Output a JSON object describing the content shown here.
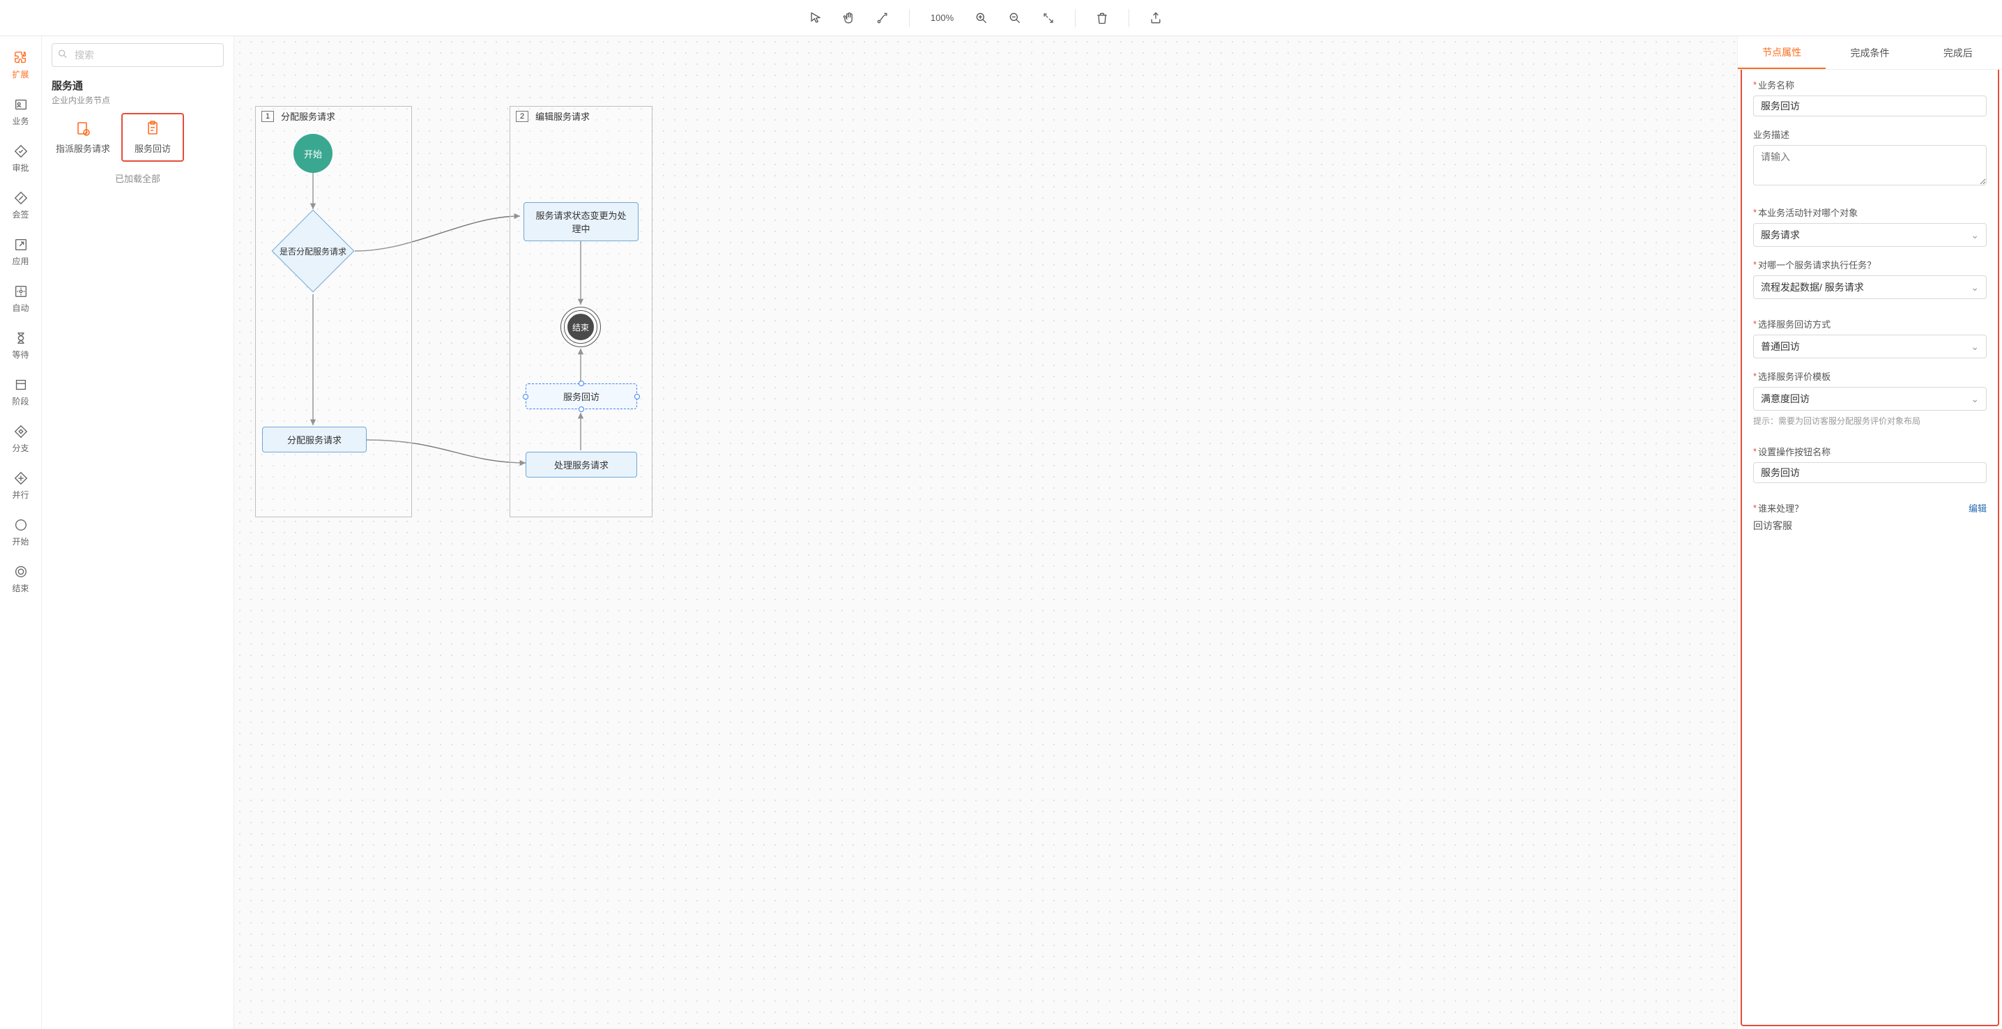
{
  "toolbar": {
    "zoom": "100%"
  },
  "rail": {
    "items": [
      {
        "label": "扩展",
        "icon": "puzzle"
      },
      {
        "label": "业务",
        "icon": "user-card"
      },
      {
        "label": "审批",
        "icon": "diamond-check"
      },
      {
        "label": "会签",
        "icon": "diamond-pen"
      },
      {
        "label": "应用",
        "icon": "arrow-out"
      },
      {
        "label": "自动",
        "icon": "auto"
      },
      {
        "label": "等待",
        "icon": "hourglass"
      },
      {
        "label": "阶段",
        "icon": "stage"
      },
      {
        "label": "分支",
        "icon": "branch"
      },
      {
        "label": "并行",
        "icon": "parallel"
      },
      {
        "label": "开始",
        "icon": "circle"
      },
      {
        "label": "结束",
        "icon": "circle-double"
      }
    ]
  },
  "palette": {
    "search_placeholder": "搜索",
    "title": "服务通",
    "subtitle": "企业内业务节点",
    "cards": [
      {
        "label": "指派服务请求"
      },
      {
        "label": "服务回访"
      }
    ],
    "footer": "已加载全部"
  },
  "canvas": {
    "lane1": {
      "num": "1",
      "title": "分配服务请求"
    },
    "lane2": {
      "num": "2",
      "title": "编辑服务请求"
    },
    "nodes": {
      "start": "开始",
      "decision": "是否分配服务请求",
      "assign": "分配服务请求",
      "status": "服务请求状态变更为处理中",
      "end": "结束",
      "revisit": "服务回访",
      "handle": "处理服务请求"
    }
  },
  "props": {
    "tabs": [
      "节点属性",
      "完成条件",
      "完成后"
    ],
    "fields": {
      "biz_name_label": "业务名称",
      "biz_name_value": "服务回访",
      "biz_desc_label": "业务描述",
      "biz_desc_placeholder": "请输入",
      "target_obj_label": "本业务活动针对哪个对象",
      "target_obj_value": "服务请求",
      "which_req_label": "对哪一个服务请求执行任务？",
      "which_req_value": "流程发起数据/ 服务请求",
      "visit_mode_label": "选择服务回访方式",
      "visit_mode_value": "普通回访",
      "eval_tpl_label": "选择服务评价模板",
      "eval_tpl_value": "满意度回访",
      "eval_tpl_hint": "提示：需要为回访客服分配服务评价对象布局",
      "btn_name_label": "设置操作按钮名称",
      "btn_name_value": "服务回访",
      "who_handle_label": "谁来处理？",
      "who_handle_edit": "编辑",
      "who_handle_value": "回访客服"
    }
  }
}
